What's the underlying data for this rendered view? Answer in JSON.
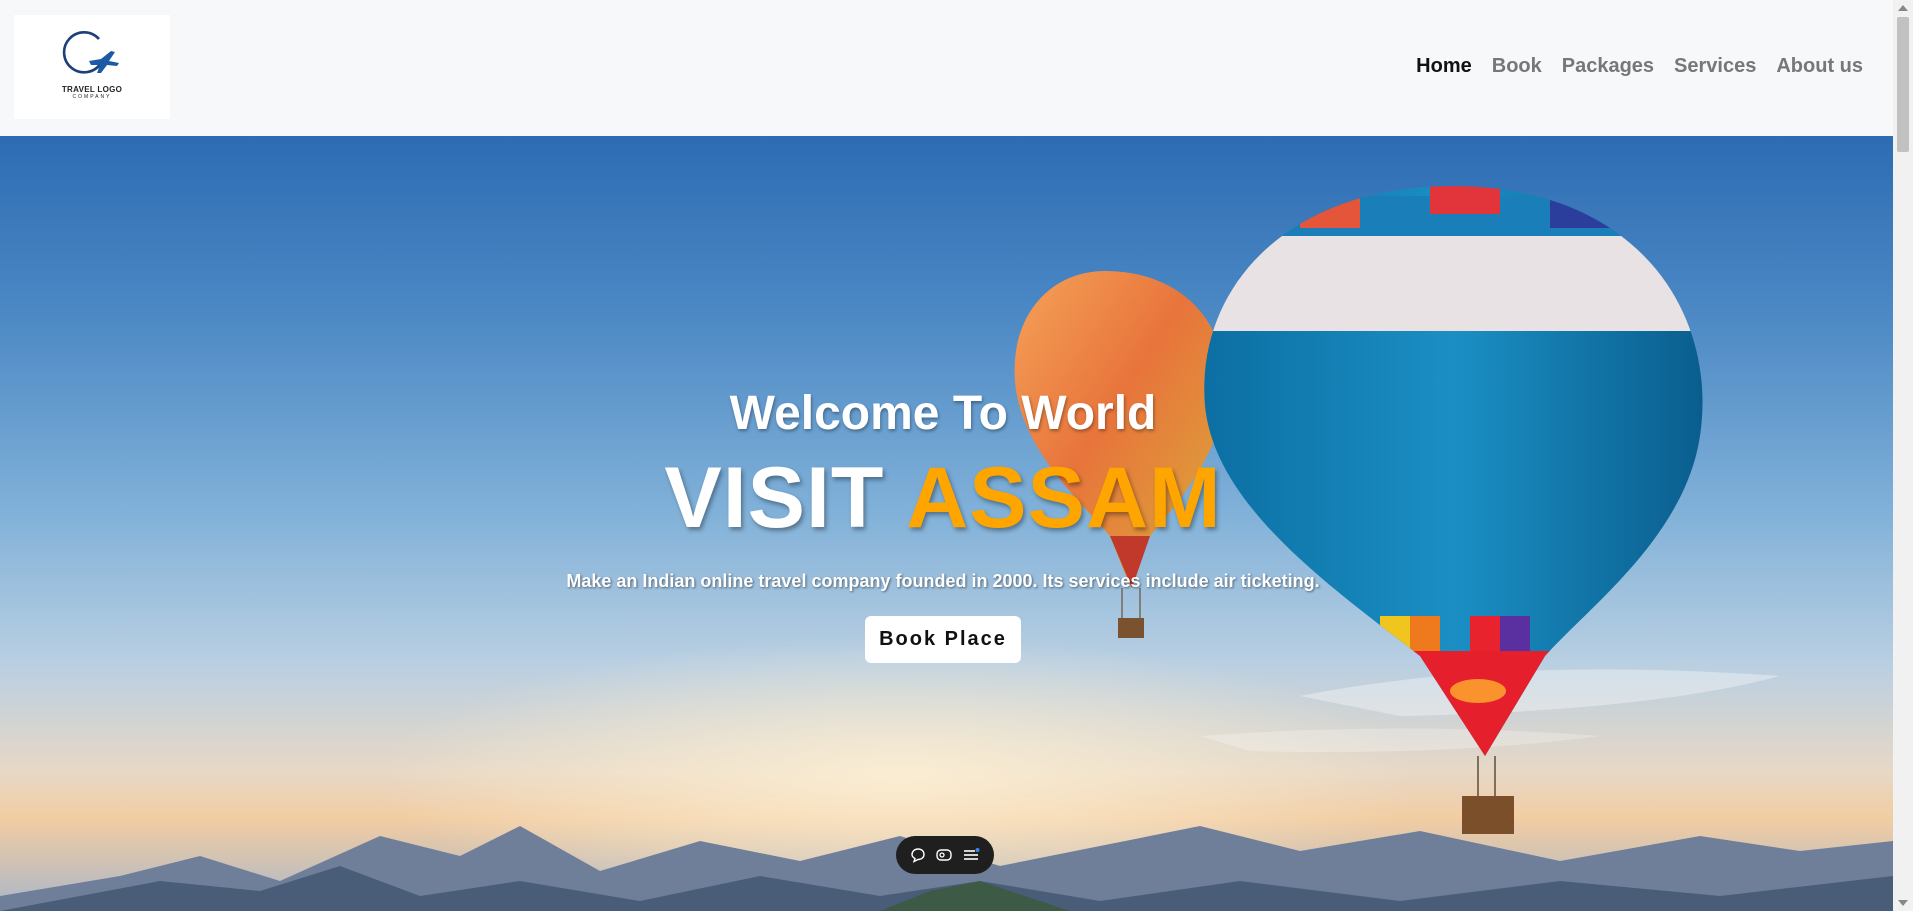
{
  "logo": {
    "title": "TRAVEL LOGO",
    "subtitle": "COMPANY",
    "icon": "plane-logo-icon"
  },
  "nav": {
    "items": [
      {
        "label": "Home",
        "active": true
      },
      {
        "label": "Book",
        "active": false
      },
      {
        "label": "Packages",
        "active": false
      },
      {
        "label": "Services",
        "active": false
      },
      {
        "label": "About us",
        "active": false
      }
    ]
  },
  "hero": {
    "welcome": "Welcome To World",
    "title_part1": "VISIT",
    "title_part2": "ASSAM",
    "tagline": "Make an Indian online travel company founded in 2000. Its services include air ticketing.",
    "button_label": "Book Place",
    "accent_color": "#ffa500"
  },
  "toolbar": {
    "icons": [
      "chat-icon",
      "preview-icon",
      "menu-icon"
    ]
  }
}
